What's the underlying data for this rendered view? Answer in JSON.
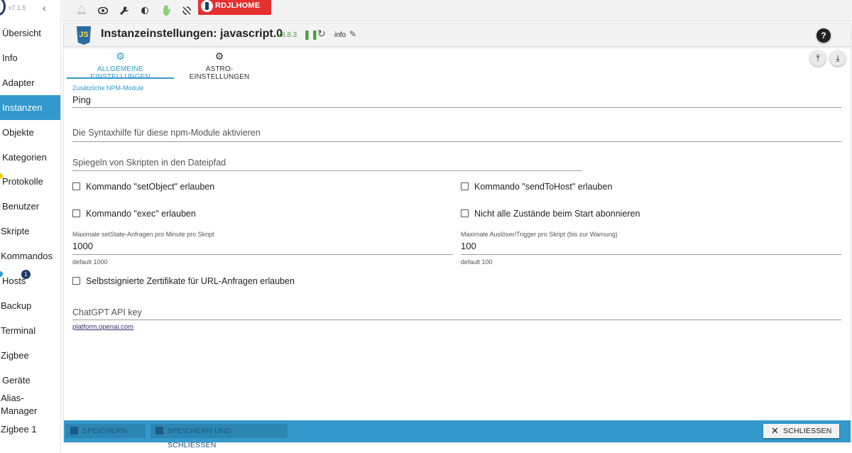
{
  "sidebar": {
    "version": "v7.1.5",
    "items": [
      {
        "label": "Übersicht"
      },
      {
        "label": "Info"
      },
      {
        "label": "Adapter"
      },
      {
        "label": "Instanzen"
      },
      {
        "label": "Objekte"
      },
      {
        "label": "Kategorien"
      },
      {
        "label": "Protokolle"
      },
      {
        "label": "Benutzer"
      },
      {
        "label": "Skripte"
      },
      {
        "label": "Kommandos"
      },
      {
        "label": "Hosts"
      },
      {
        "label": "Backup"
      },
      {
        "label": "Terminal"
      },
      {
        "label": "Zigbee"
      },
      {
        "label": "Geräte"
      },
      {
        "label": "Alias-Manager"
      },
      {
        "label": "Zigbee 1"
      }
    ],
    "hosts_badge": "1"
  },
  "toolbar": {
    "host_button": "RDJLHOME"
  },
  "panel": {
    "title": "Instanzeinstellungen: javascript.0",
    "version": "v8.8.3",
    "loglevel": "info",
    "js_logo": "JS"
  },
  "tabs": [
    {
      "label": "ALLGEMEINE EINSTELLUNGEN",
      "icon": "gear-icon"
    },
    {
      "label": "ASTRO-EINSTELLUNGEN",
      "icon": "gear-outline-icon"
    }
  ],
  "form": {
    "npm_label": "Zusätzliche NPM-Module",
    "npm_value": "Ping",
    "syntax_help": "Die Syntaxhilfe für diese npm-Module aktivieren",
    "mirror_path": "Spiegeln von Skripten in den Dateipfad",
    "cb_setobject": "Kommando \"setObject\" erlauben",
    "cb_sendtohost": "Kommando \"sendToHost\" erlauben",
    "cb_exec": "Kommando \"exec\" erlauben",
    "cb_nosubscribe": "Nicht alle Zustände beim Start abonnieren",
    "max_setstate_label": "Maximale setState-Anfragen pro Minute pro Skript",
    "max_setstate_value": "1000",
    "max_setstate_default": "default 1000",
    "max_trigger_label": "Maximale Auslöser/Trigger pro Skript (bis zur Warnung)",
    "max_trigger_value": "100",
    "max_trigger_default": "default 100",
    "cb_selfsigned": "Selbstsignierte Zertifikate für URL-Anfragen erlauben",
    "chatgpt_label": "ChatGPT API key",
    "chatgpt_link": "platform.openai.com"
  },
  "footer": {
    "save": "SPEICHERN",
    "save_close": "SPEICHERN UND SCHLIESSEN",
    "close": "SCHLIESSEN"
  },
  "colors": {
    "accent": "#3399cc",
    "host_button": "#e53030",
    "green": "#4a9e3a"
  }
}
